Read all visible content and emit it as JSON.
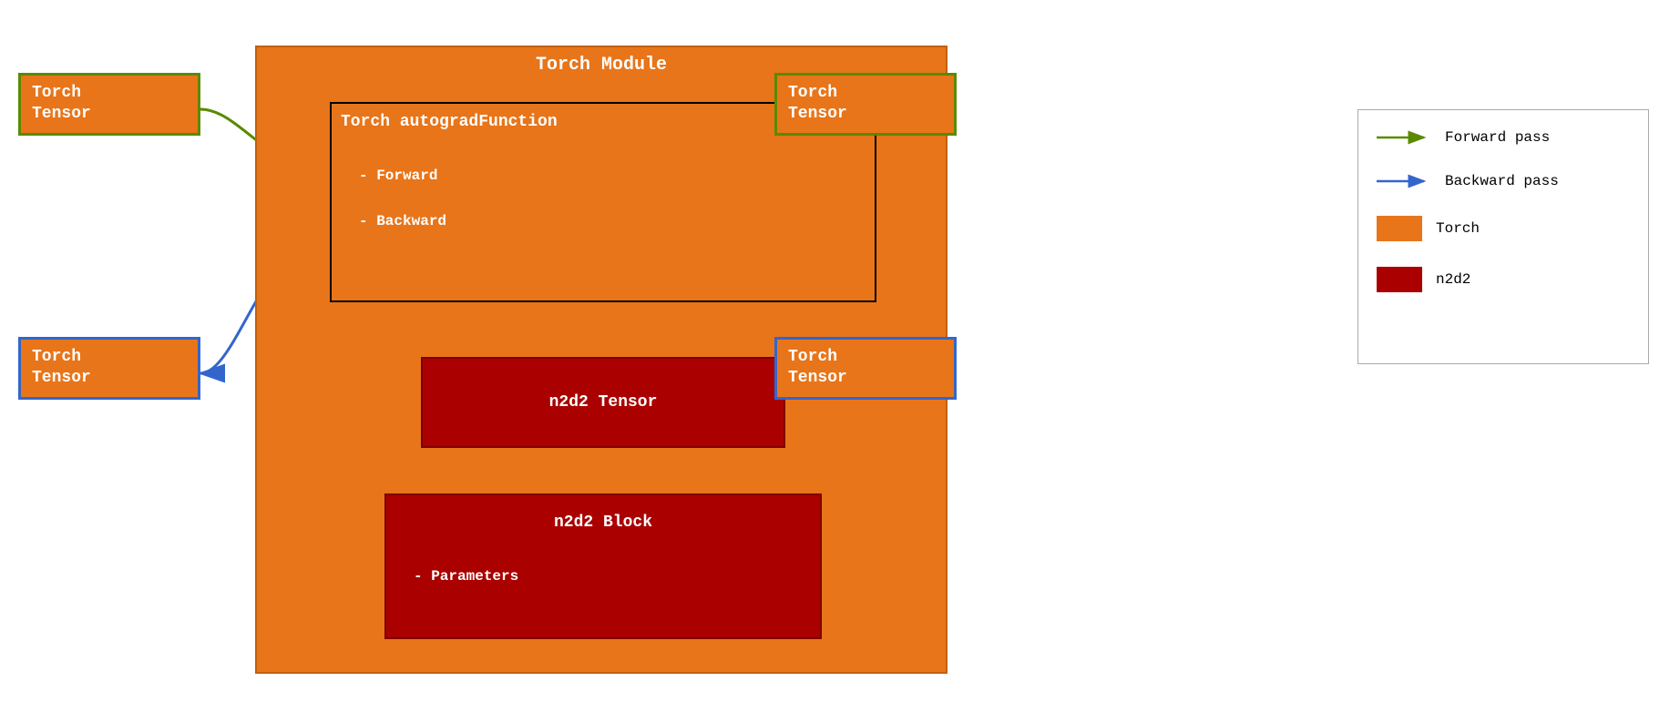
{
  "diagram": {
    "torch_module_label": "Torch Module",
    "autograd_label": "Torch autogradFunction",
    "autograd_forward": "- Forward",
    "autograd_backward": "- Backward",
    "n2d2_tensor_label": "n2d2 Tensor",
    "n2d2_block_label": "n2d2 Block",
    "n2d2_block_params": "- Parameters",
    "tensor_top_left": "Torch\nTensor",
    "tensor_top_right": "Torch\nTensor",
    "tensor_bottom_left": "Torch\nTensor",
    "tensor_bottom_right": "Torch\nTensor"
  },
  "legend": {
    "forward_label": "Forward pass",
    "backward_label": "Backward pass",
    "torch_label": "Torch",
    "n2d2_label": "n2d2",
    "colors": {
      "forward_arrow": "#5a8a00",
      "backward_arrow": "#3366cc",
      "torch_bg": "#E8751A",
      "n2d2_bg": "#AA0000"
    }
  }
}
